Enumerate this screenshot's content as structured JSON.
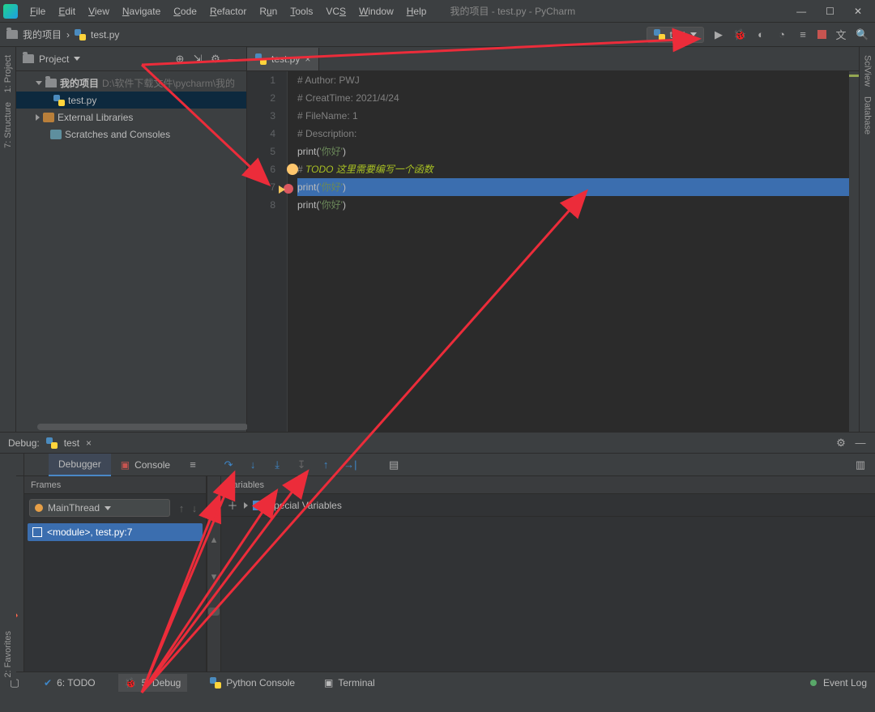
{
  "menu": {
    "file": "File",
    "edit": "Edit",
    "view": "View",
    "navigate": "Navigate",
    "code": "Code",
    "refactor": "Refactor",
    "run": "Run",
    "tools": "Tools",
    "vcs": "VCS",
    "window": "Window",
    "help": "Help"
  },
  "title": "我的项目 - test.py - PyCharm",
  "breadcrumb": {
    "project": "我的项目",
    "file": "test.py"
  },
  "runconfig": {
    "name": "test"
  },
  "projectPanel": {
    "title": "Project",
    "root": "我的项目",
    "rootPath": "D:\\软件下载文件\\pycharm\\我的",
    "file": "test.py",
    "external": "External Libraries",
    "scratches": "Scratches and Consoles"
  },
  "editor": {
    "tab": "test.py",
    "lines": [
      {
        "n": 1,
        "html": "<span class='cm'># Author: PWJ</span>"
      },
      {
        "n": 2,
        "html": "<span class='cm'># CreatTime: 2021/4/24</span>"
      },
      {
        "n": 3,
        "html": "<span class='cm'># FileName: 1</span>"
      },
      {
        "n": 4,
        "html": "<span class='cm'># Description:</span>"
      },
      {
        "n": 5,
        "html": "<span class='fn'>print</span>(<span class='str'>'你好'</span>)"
      },
      {
        "n": 6,
        "html": "<span class='cm'># </span><span class='todo'>TODO 这里需要编写一个函数</span>"
      },
      {
        "n": 7,
        "hl": true,
        "html": "<span class='fn'>print</span>(<span class='str'>'你好'</span>)"
      },
      {
        "n": 8,
        "html": "<span class='fn'>print</span>(<span class='str'>'你好'</span>)"
      }
    ]
  },
  "debug": {
    "title": "Debug:",
    "session": "test",
    "tabs": {
      "debugger": "Debugger",
      "console": "Console"
    },
    "frames": {
      "title": "Frames",
      "thread": "MainThread",
      "frame": "<module>, test.py:7"
    },
    "variables": {
      "title": "Variables",
      "special": "Special Variables"
    }
  },
  "leftStrip": {
    "project": "1: Project",
    "structure": "7: Structure",
    "favorites": "2: Favorites"
  },
  "rightStrip": {
    "sciview": "SciView",
    "database": "Database"
  },
  "status": {
    "todo": "6: TODO",
    "debug": "5: Debug",
    "pyconsole": "Python Console",
    "terminal": "Terminal",
    "eventlog": "Event Log"
  }
}
